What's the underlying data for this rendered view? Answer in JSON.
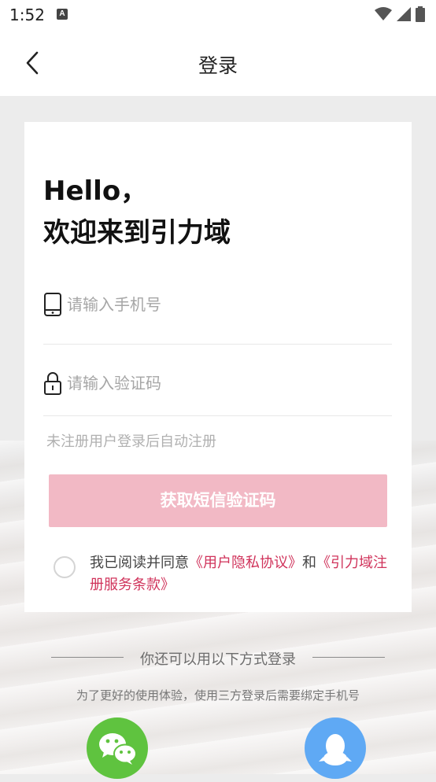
{
  "status_bar": {
    "time": "1:52",
    "notif_icon": "a-icon"
  },
  "header": {
    "title": "登录",
    "back_icon": "chevron-left-icon"
  },
  "card": {
    "greeting_line1": "Hello，",
    "greeting_line2": "欢迎来到引力域",
    "phone_field": {
      "placeholder": "请输入手机号",
      "value": "",
      "icon": "phone-icon"
    },
    "code_field": {
      "placeholder": "请输入验证码",
      "value": "",
      "icon": "lock-icon"
    },
    "hint": "未注册用户登录后自动注册",
    "sms_button_label": "获取短信验证码",
    "agreement": {
      "prefix": "我已阅读并同意",
      "privacy_link": "《用户隐私协议》",
      "conjunction": "和",
      "terms_link": "《引力域注册服务条款》",
      "checked": false
    }
  },
  "alt_login": {
    "title": "你还可以用以下方式登录",
    "note": "为了更好的使用体验，使用三方登录后需要绑定手机号",
    "providers": [
      {
        "name": "wechat",
        "icon": "wechat-icon",
        "color": "#5fc33f"
      },
      {
        "name": "qq",
        "icon": "qq-icon",
        "color": "#5fa9f4"
      }
    ]
  },
  "colors": {
    "accent": "#d0335b",
    "button_disabled": "#f2b9c5",
    "background": "#ececec"
  }
}
